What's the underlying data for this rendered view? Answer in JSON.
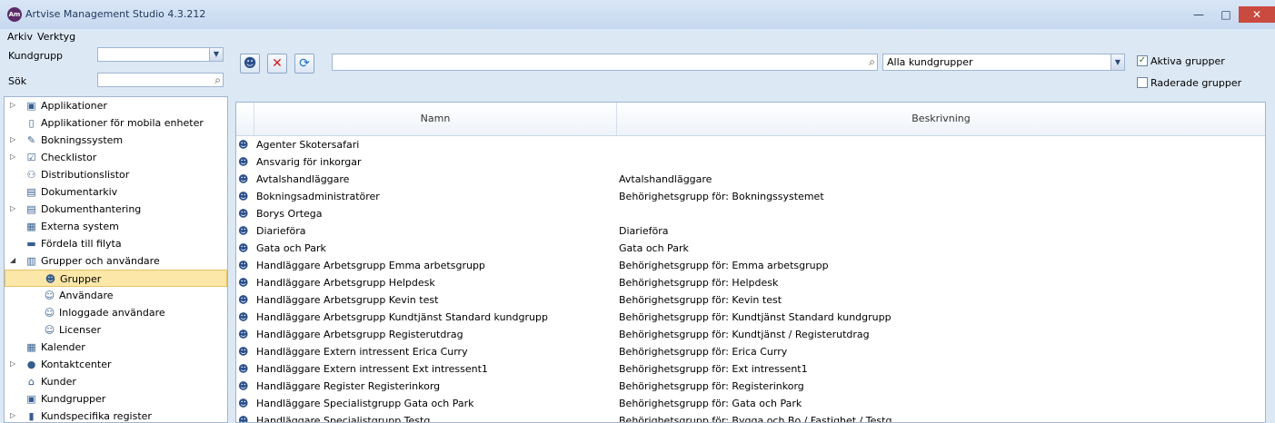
{
  "window": {
    "title": "Artvise Management Studio 4.3.212",
    "app_icon_text": "Am",
    "minimize": "—",
    "maximize": "□",
    "close": "✕"
  },
  "menu": [
    "Arkiv",
    "Verktyg"
  ],
  "filters": {
    "kundgrupp_label": "Kundgrupp",
    "kundgrupp_value": "",
    "sok_label": "Sök",
    "sok_value": ""
  },
  "toolbar": {
    "search_value": "",
    "group_filter_value": "Alla kundgrupper",
    "aktiva_label": "Aktiva grupper",
    "aktiva_checked": true,
    "raderade_label": "Raderade grupper",
    "raderade_checked": false
  },
  "tree": [
    {
      "label": "Applikationer",
      "icon": "applications-icon",
      "glyph": "▣",
      "level": 0,
      "expander": "▷"
    },
    {
      "label": "Applikationer för mobila enheter",
      "icon": "mobile-icon",
      "glyph": "▯",
      "level": 0,
      "expander": ""
    },
    {
      "label": "Bokningssystem",
      "icon": "booking-icon",
      "glyph": "✎",
      "level": 0,
      "expander": "▷"
    },
    {
      "label": "Checklistor",
      "icon": "checklist-icon",
      "glyph": "☑",
      "level": 0,
      "expander": "▷"
    },
    {
      "label": "Distributionslistor",
      "icon": "distribution-icon",
      "glyph": "⚇",
      "level": 0,
      "expander": ""
    },
    {
      "label": "Dokumentarkiv",
      "icon": "archive-icon",
      "glyph": "▤",
      "level": 0,
      "expander": ""
    },
    {
      "label": "Dokumenthantering",
      "icon": "document-icon",
      "glyph": "▤",
      "level": 0,
      "expander": "▷"
    },
    {
      "label": "Externa system",
      "icon": "external-icon",
      "glyph": "▦",
      "level": 0,
      "expander": ""
    },
    {
      "label": "Fördela till filyta",
      "icon": "folder-icon",
      "glyph": "▬",
      "level": 0,
      "expander": ""
    },
    {
      "label": "Grupper och användare",
      "icon": "groups-users-icon",
      "glyph": "▥",
      "level": 0,
      "expander": "◢"
    },
    {
      "label": "Grupper",
      "icon": "group-icon",
      "glyph": "☻",
      "level": 1,
      "expander": "",
      "selected": true
    },
    {
      "label": "Användare",
      "icon": "user-icon",
      "glyph": "☺",
      "level": 1,
      "expander": ""
    },
    {
      "label": "Inloggade användare",
      "icon": "logged-user-icon",
      "glyph": "☺",
      "level": 1,
      "expander": ""
    },
    {
      "label": "Licenser",
      "icon": "license-icon",
      "glyph": "☺",
      "level": 1,
      "expander": ""
    },
    {
      "label": "Kalender",
      "icon": "calendar-icon",
      "glyph": "▦",
      "level": 0,
      "expander": ""
    },
    {
      "label": "Kontaktcenter",
      "icon": "contact-center-icon",
      "glyph": "●",
      "level": 0,
      "expander": "▷"
    },
    {
      "label": "Kunder",
      "icon": "customers-icon",
      "glyph": "⌂",
      "level": 0,
      "expander": ""
    },
    {
      "label": "Kundgrupper",
      "icon": "customer-groups-icon",
      "glyph": "▣",
      "level": 0,
      "expander": ""
    },
    {
      "label": "Kundspecifika register",
      "icon": "register-icon",
      "glyph": "▮",
      "level": 0,
      "expander": "▷"
    }
  ],
  "grid": {
    "columns": [
      "Namn",
      "Beskrivning"
    ],
    "rows": [
      {
        "name": "Agenter Skotersafari",
        "desc": ""
      },
      {
        "name": "Ansvarig för inkorgar",
        "desc": ""
      },
      {
        "name": "Avtalshandläggare",
        "desc": "Avtalshandläggare"
      },
      {
        "name": "Bokningsadministratörer",
        "desc": "Behörighetsgrupp för: Bokningssystemet"
      },
      {
        "name": "Borys Ortega",
        "desc": ""
      },
      {
        "name": "Diarieföra",
        "desc": "Diarieföra"
      },
      {
        "name": "Gata och Park",
        "desc": "Gata och Park"
      },
      {
        "name": "Handläggare Arbetsgrupp Emma arbetsgrupp",
        "desc": "Behörighetsgrupp för: Emma arbetsgrupp"
      },
      {
        "name": "Handläggare Arbetsgrupp Helpdesk",
        "desc": "Behörighetsgrupp för: Helpdesk"
      },
      {
        "name": "Handläggare Arbetsgrupp Kevin test",
        "desc": "Behörighetsgrupp för: Kevin test"
      },
      {
        "name": "Handläggare Arbetsgrupp Kundtjänst Standard kundgrupp",
        "desc": "Behörighetsgrupp för: Kundtjänst Standard kundgrupp"
      },
      {
        "name": "Handläggare Arbetsgrupp Registerutdrag",
        "desc": "Behörighetsgrupp för: Kundtjänst / Registerutdrag"
      },
      {
        "name": "Handläggare Extern intressent Erica Curry",
        "desc": "Behörighetsgrupp för: Erica Curry"
      },
      {
        "name": "Handläggare Extern intressent Ext intressent1",
        "desc": "Behörighetsgrupp för: Ext intressent1"
      },
      {
        "name": "Handläggare Register Registerinkorg",
        "desc": "Behörighetsgrupp för: Registerinkorg"
      },
      {
        "name": "Handläggare Specialistgrupp Gata och Park",
        "desc": "Behörighetsgrupp för: Gata och Park"
      },
      {
        "name": "Handläggare Specialistgrupp Testg",
        "desc": "Behörighetsgrupp för: Bygga och Bo / Fastighet / Testg"
      }
    ]
  }
}
